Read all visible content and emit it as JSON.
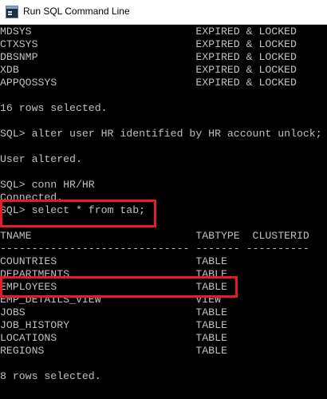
{
  "window": {
    "title": "Run SQL Command Line"
  },
  "console": {
    "lines": [
      "MDSYS                          EXPIRED & LOCKED",
      "CTXSYS                         EXPIRED & LOCKED",
      "DBSNMP                         EXPIRED & LOCKED",
      "XDB                            EXPIRED & LOCKED",
      "APPQOSSYS                      EXPIRED & LOCKED",
      "",
      "16 rows selected.",
      "",
      "SQL> alter user HR identified by HR account unlock;",
      "",
      "User altered.",
      "",
      "SQL> conn HR/HR",
      "Connected.",
      "SQL> select * from tab;",
      "",
      "TNAME                          TABTYPE  CLUSTERID",
      "------------------------------ ------- ----------",
      "COUNTRIES                      TABLE",
      "DEPARTMENTS                    TABLE",
      "EMPLOYEES                      TABLE",
      "EMP_DETAILS_VIEW               VIEW",
      "JOBS                           TABLE",
      "JOB_HISTORY                    TABLE",
      "LOCATIONS                      TABLE",
      "REGIONS                        TABLE",
      "",
      "8 rows selected."
    ]
  },
  "colors": {
    "console_bg": "#000000",
    "console_text": "#c0c0c0",
    "highlight": "#e11d25"
  }
}
